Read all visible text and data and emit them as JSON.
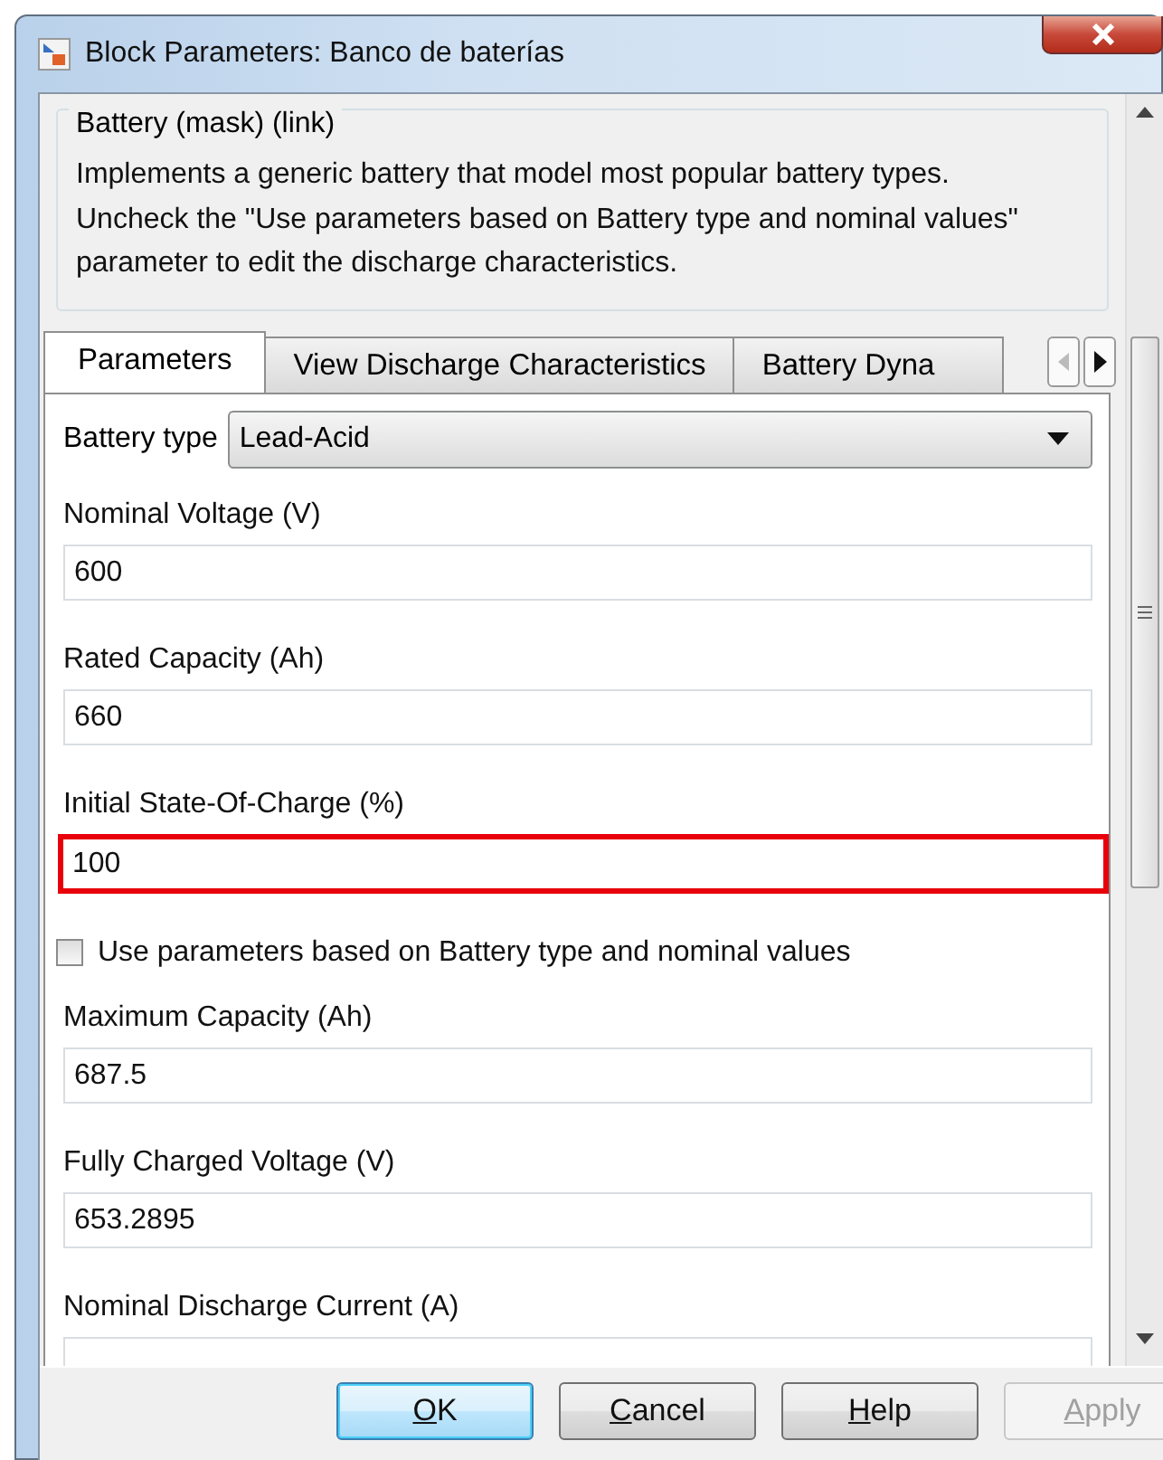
{
  "window": {
    "title": "Block Parameters: Banco de baterías"
  },
  "description": {
    "title": "Battery (mask) (link)",
    "text": "Implements a generic battery that model most popular battery types. Uncheck the \"Use parameters based on Battery type and nominal values\" parameter to edit the discharge characteristics."
  },
  "tabs": [
    {
      "label": "Parameters",
      "selected": true
    },
    {
      "label": "View Discharge Characteristics",
      "selected": false
    },
    {
      "label": "Battery Dyna",
      "selected": false
    }
  ],
  "battery_type": {
    "label": "Battery type",
    "value": "Lead-Acid"
  },
  "parameters": [
    {
      "kind": "field",
      "label": "Nominal Voltage (V)",
      "value": "600",
      "highlighted": false
    },
    {
      "kind": "field",
      "label": "Rated Capacity (Ah)",
      "value": "660",
      "highlighted": false
    },
    {
      "kind": "field",
      "label": "Initial State-Of-Charge (%)",
      "value": "100",
      "highlighted": true
    },
    {
      "kind": "checkbox",
      "label": "Use parameters based on Battery type and nominal values",
      "checked": false
    },
    {
      "kind": "field",
      "label": "Maximum Capacity (Ah)",
      "value": "687.5",
      "highlighted": false
    },
    {
      "kind": "field",
      "label": "Fully Charged Voltage (V)",
      "value": "653.2895",
      "highlighted": false
    },
    {
      "kind": "field",
      "label": "Nominal Discharge Current (A)",
      "highlighted": false
    }
  ],
  "buttons": [
    {
      "label": "OK",
      "default": true,
      "disabled": false
    },
    {
      "label": "Cancel",
      "default": false,
      "disabled": false
    },
    {
      "label": "Help",
      "default": false,
      "disabled": false
    },
    {
      "label": "Apply",
      "default": false,
      "disabled": true
    }
  ]
}
